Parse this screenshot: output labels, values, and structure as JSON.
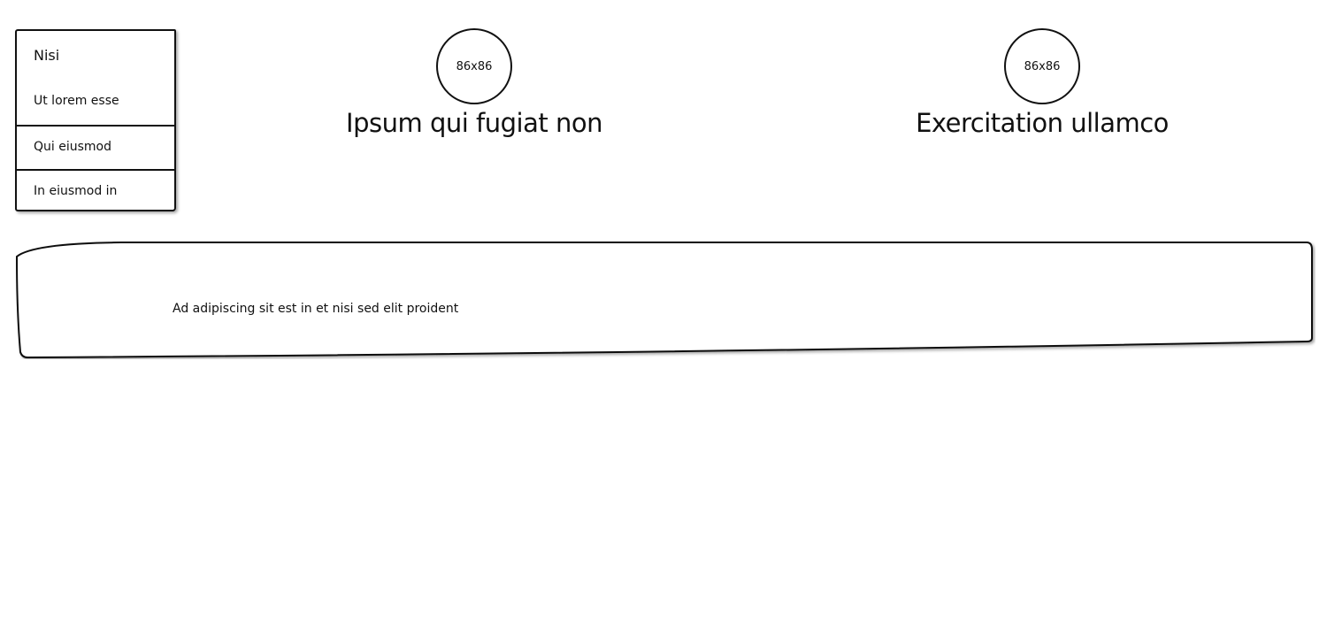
{
  "menu": {
    "title": "Nisi",
    "items": [
      {
        "label": "Ut lorem esse"
      },
      {
        "label": "Qui eiusmod"
      },
      {
        "label": "In eiusmod in"
      }
    ]
  },
  "profiles": [
    {
      "avatar_label": "86x86",
      "name": "Ipsum qui fugiat non"
    },
    {
      "avatar_label": "86x86",
      "name": "Exercitation ullamco"
    }
  ],
  "panel": {
    "text": "Ad adipiscing sit est in et nisi sed elit proident"
  }
}
